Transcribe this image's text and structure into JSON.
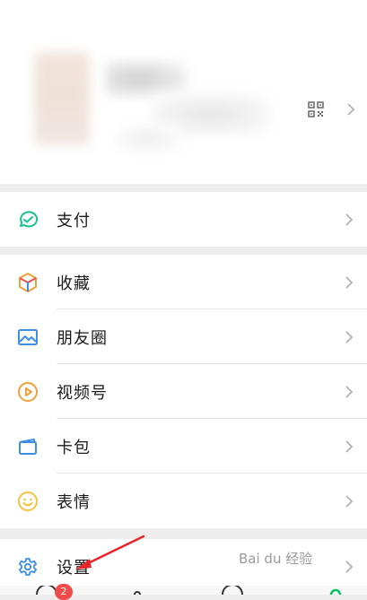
{
  "menu": {
    "pay": {
      "label": "支付",
      "icon": "pay-icon"
    },
    "favorites": {
      "label": "收藏",
      "icon": "favorites-cube-icon"
    },
    "moments": {
      "label": "朋友圈",
      "icon": "moments-image-icon"
    },
    "channels": {
      "label": "视频号",
      "icon": "channels-play-icon"
    },
    "cards": {
      "label": "卡包",
      "icon": "card-wallet-icon"
    },
    "stickers": {
      "label": "表情",
      "icon": "sticker-smile-icon"
    },
    "settings": {
      "label": "设置",
      "icon": "gear-icon"
    }
  },
  "tabbar": {
    "chats_badge": "2"
  },
  "watermark": {
    "text": "Bai du 经验"
  },
  "colors": {
    "pay_green": "#17c295",
    "blue": "#3d8ee6",
    "orange": "#f0a03a",
    "yellow": "#f5c242",
    "arrow_red": "#e8232a"
  }
}
